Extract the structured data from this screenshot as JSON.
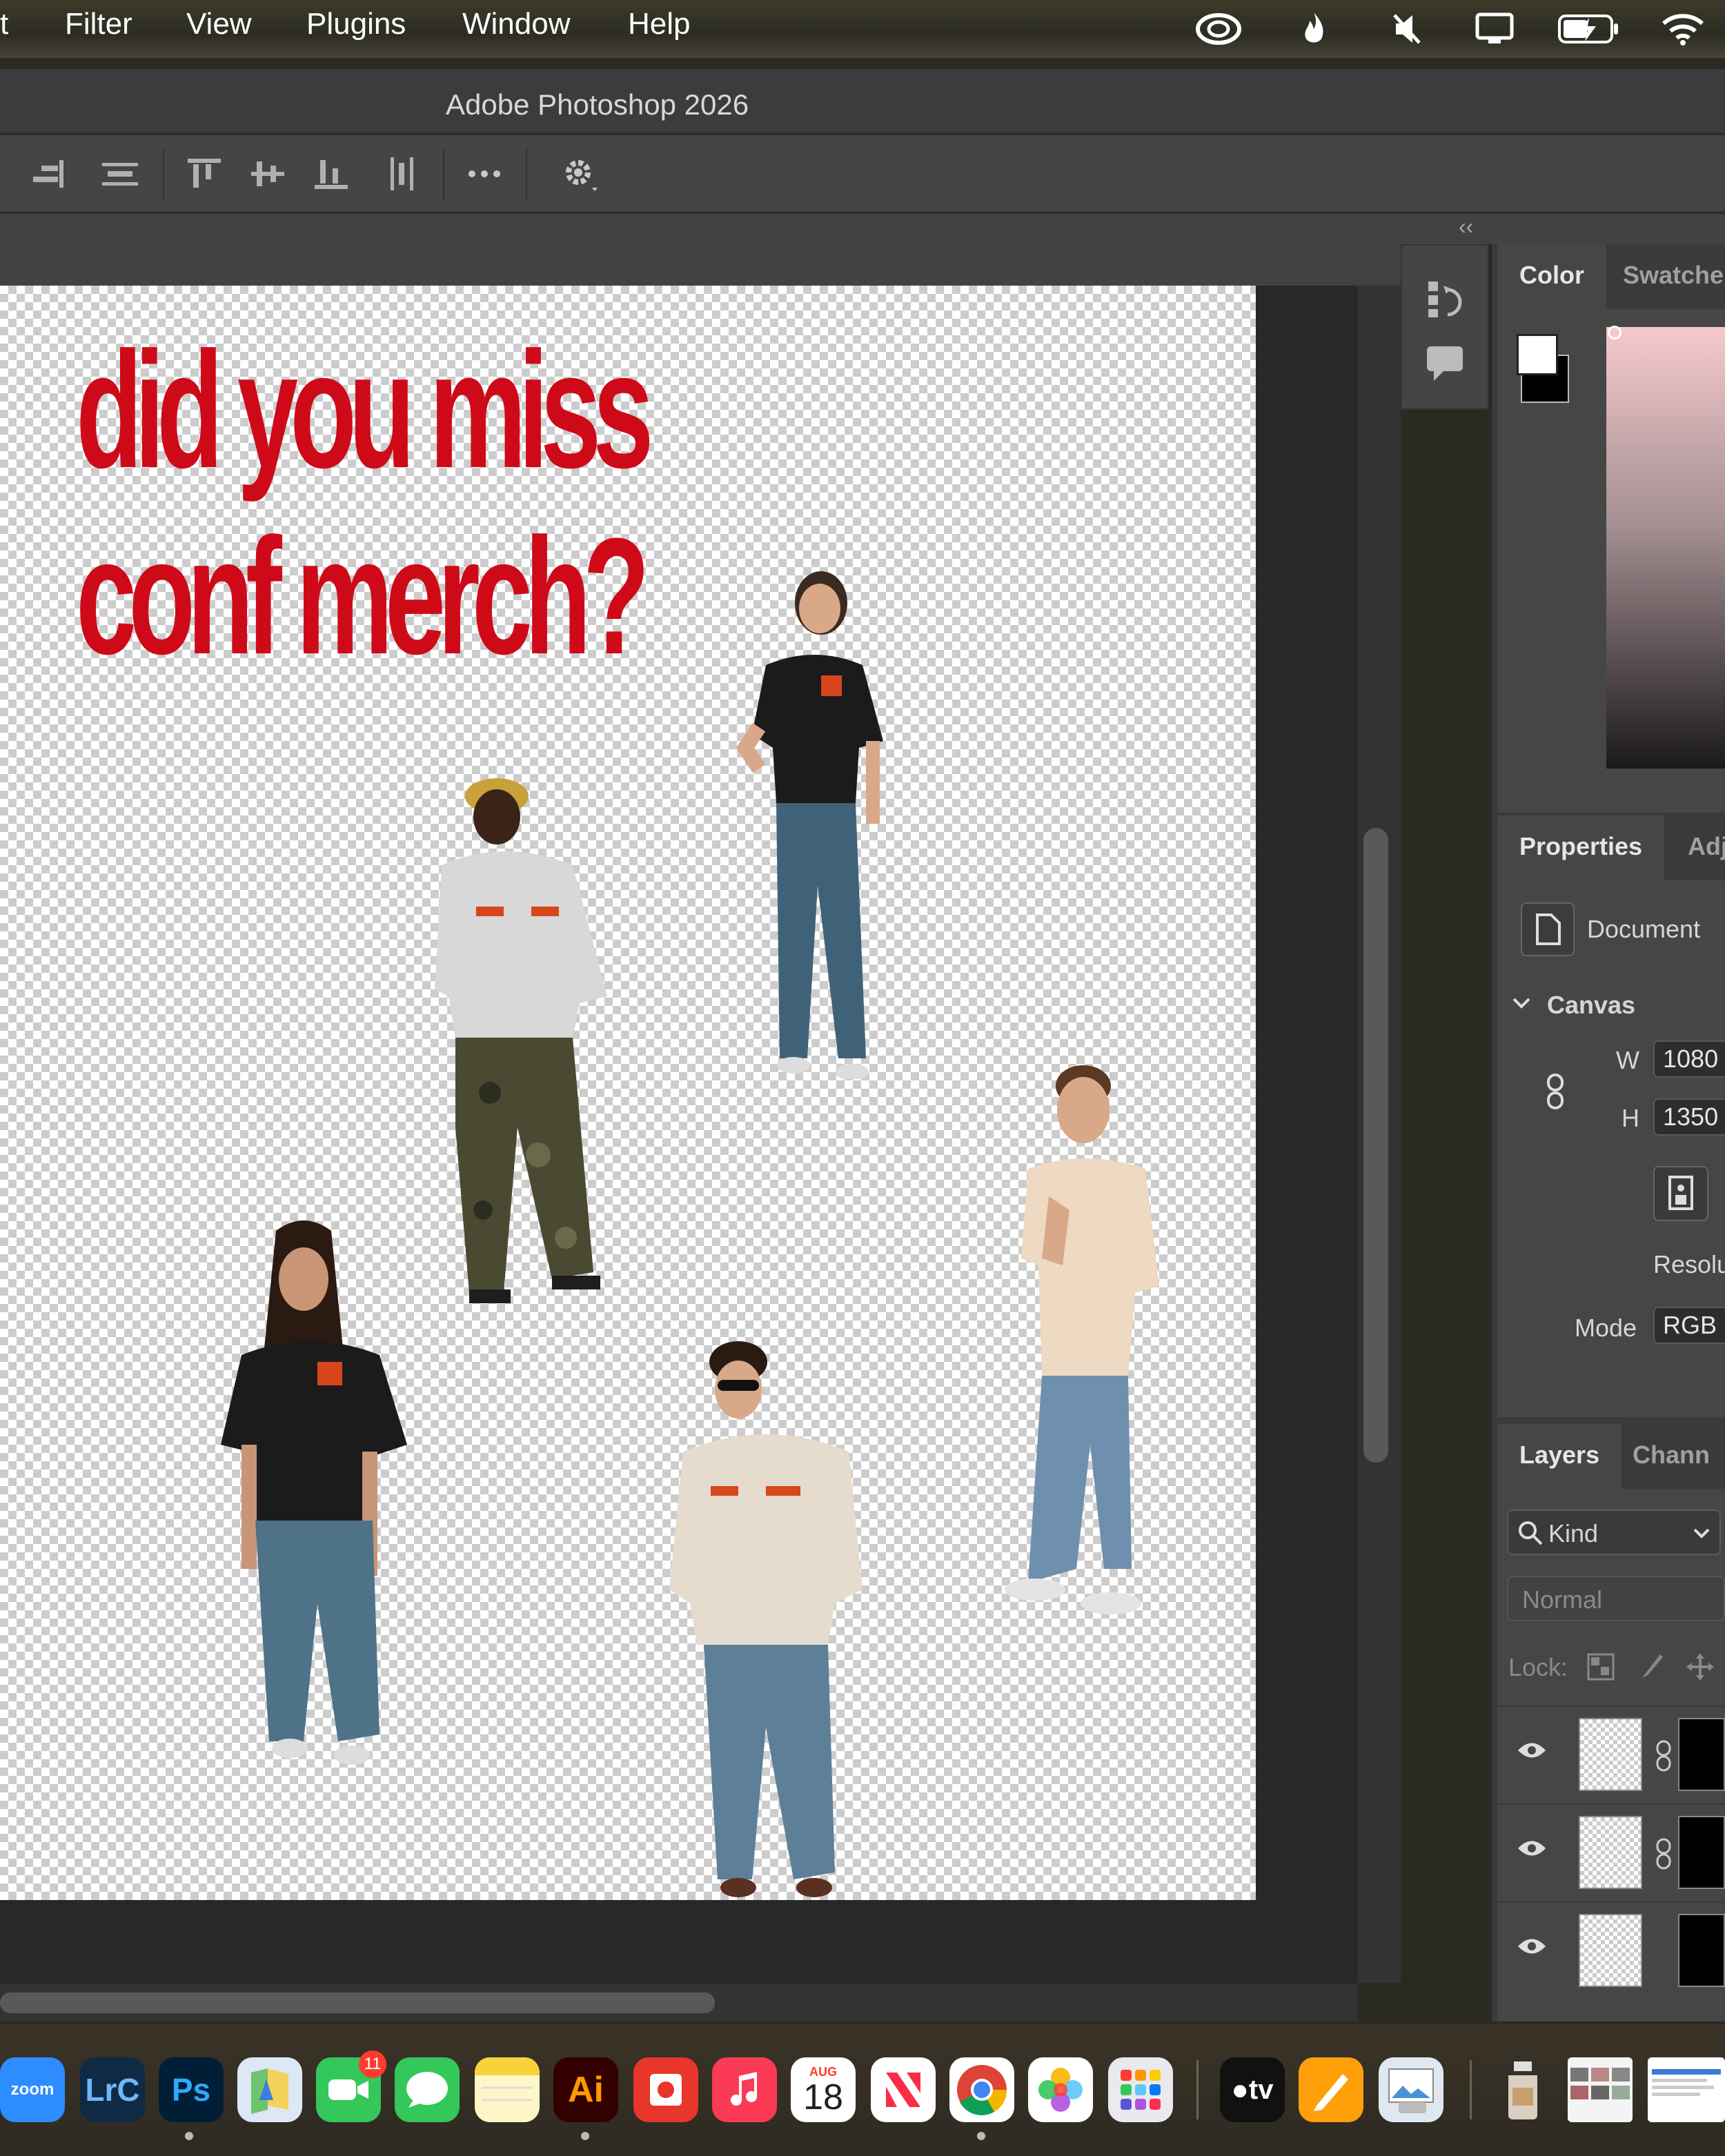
{
  "menubar": {
    "items": [
      "t",
      "Filter",
      "View",
      "Plugins",
      "Window",
      "Help"
    ]
  },
  "window": {
    "title": "Adobe Photoshop 2026"
  },
  "canvas": {
    "headline_line1": "did you miss",
    "headline_line2": "conf merch?",
    "headline_color": "#cf0a18"
  },
  "color_panel": {
    "tabs": [
      "Color",
      "Swatche"
    ],
    "foreground": "#ffffff",
    "background": "#000000"
  },
  "properties_panel": {
    "tabs": [
      "Properties",
      "Adj"
    ],
    "document_label": "Document",
    "section": "Canvas",
    "width_label": "W",
    "width_value": "1080",
    "height_label": "H",
    "height_value": "1350",
    "resolution_label": "Resolu",
    "mode_label": "Mode",
    "mode_value": "RGB"
  },
  "layers_panel": {
    "tabs": [
      "Layers",
      "Chann"
    ],
    "filter_label": "Kind",
    "blend_mode": "Normal",
    "lock_label": "Lock:",
    "layer_count_visible": 3
  },
  "dock": {
    "zoom_label": "zoom",
    "lrc_label": "LrC",
    "ps_label": "Ps",
    "facetime_badge": "11",
    "ai_label": "Ai",
    "calendar_month": "AUG",
    "calendar_day": "18",
    "tv_label": "tv"
  },
  "icons": [
    "creative-cloud-icon",
    "flame-icon",
    "mute-icon",
    "display-icon",
    "battery-icon",
    "wifi-icon",
    "gear-icon",
    "more-icon"
  ]
}
